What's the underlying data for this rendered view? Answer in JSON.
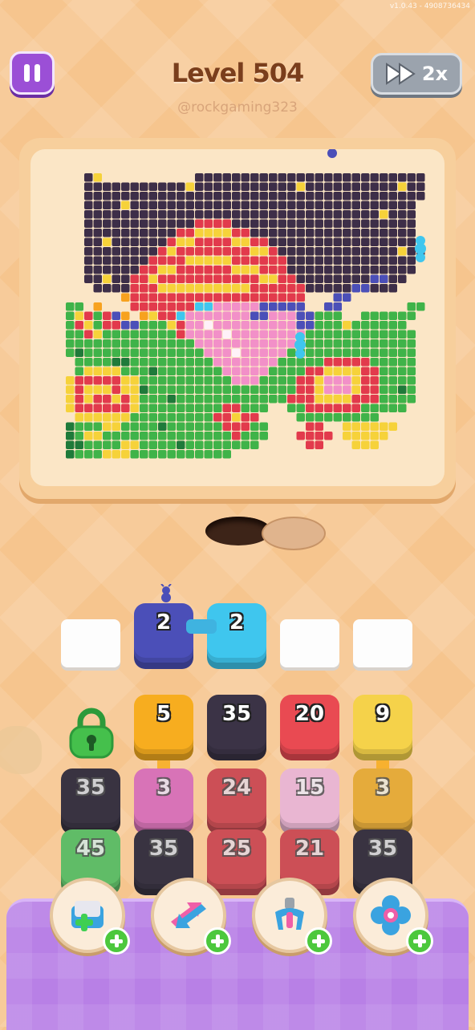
{
  "app": {
    "version": "v1.0.43 - 4908736434"
  },
  "header": {
    "title": "Level 504",
    "username": "@rockgaming323",
    "speed_label": "2x"
  },
  "colors": {
    "purple_button": "#9b4fd6",
    "dark": "#3b3346",
    "navy": "#4b4fb8",
    "cyan": "#3fc6ee",
    "orange": "#f7ad1f",
    "red": "#e94a52",
    "yellow": "#f5d24a",
    "pink": "#ef6fc5",
    "lightpink": "#f8b6da",
    "green": "#51c65a",
    "tray": "#b880e6"
  },
  "slots": {
    "filled": [
      {
        "value": "2",
        "color": "navy"
      },
      {
        "value": "2",
        "color": "cyan"
      }
    ],
    "empty_count": 3
  },
  "grid": {
    "rows": [
      [
        {
          "locked": true
        },
        {
          "value": "5",
          "color": "orange"
        },
        {
          "value": "35",
          "color": "dark"
        },
        {
          "value": "20",
          "color": "red"
        },
        {
          "value": "9",
          "color": "yellow"
        }
      ],
      [
        {
          "value": "35",
          "color": "dark"
        },
        {
          "value": "3",
          "color": "pink"
        },
        {
          "value": "24",
          "color": "red"
        },
        {
          "value": "15",
          "color": "lightpink"
        },
        {
          "value": "3",
          "color": "orange"
        }
      ],
      [
        {
          "value": "45",
          "color": "green"
        },
        {
          "value": "35",
          "color": "dark"
        },
        {
          "value": "25",
          "color": "red"
        },
        {
          "value": "21",
          "color": "red"
        },
        {
          "value": "35",
          "color": "dark"
        }
      ]
    ]
  },
  "boosters": [
    {
      "icon": "add-slot-icon"
    },
    {
      "icon": "swap-arrows-icon"
    },
    {
      "icon": "magnet-claw-icon"
    },
    {
      "icon": "flower-gem-icon"
    }
  ]
}
